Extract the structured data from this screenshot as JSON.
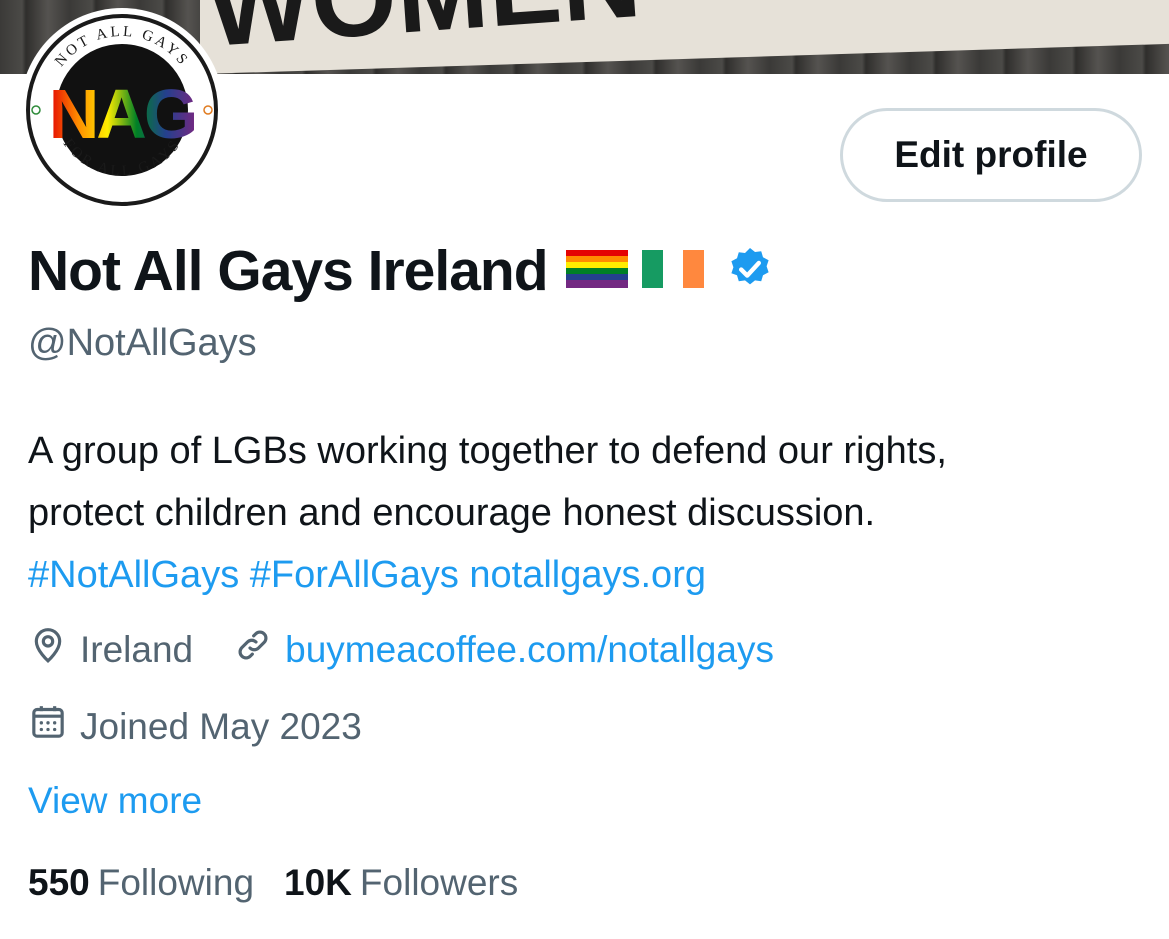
{
  "profile": {
    "name": "Not All Gays Ireland",
    "handle": "@NotAllGays",
    "edit_button_label": "Edit profile",
    "bio": {
      "line1": "A group of LGBs working together to defend our rights,",
      "line2": "protect children and encourage honest discussion.",
      "hashtag1": "#NotAllGays",
      "hashtag2": "#ForAllGays",
      "website": "notallgays.org"
    },
    "location": "Ireland",
    "link": "buymeacoffee.com/notallgays",
    "joined": "Joined May 2023",
    "view_more": "View more",
    "following_count": "550",
    "following_label": "Following",
    "followers_count": "10K",
    "followers_label": "Followers"
  },
  "avatar": {
    "logo_text": "NAG",
    "ring_top": "NOT ALL GAYS",
    "ring_bottom": "FOR ALL GAYS"
  },
  "banner": {
    "text": "WOMEN"
  },
  "icons": {
    "name_flags": [
      "rainbow-flag-icon",
      "ireland-flag-icon"
    ],
    "verified": "verified-badge-icon",
    "location": "location-pin-icon",
    "link": "link-icon",
    "calendar": "calendar-icon"
  },
  "colors": {
    "accent": "#1d9bf0",
    "secondary_text": "#536471",
    "primary_text": "#0f1419",
    "button_border": "#cfd9de"
  }
}
